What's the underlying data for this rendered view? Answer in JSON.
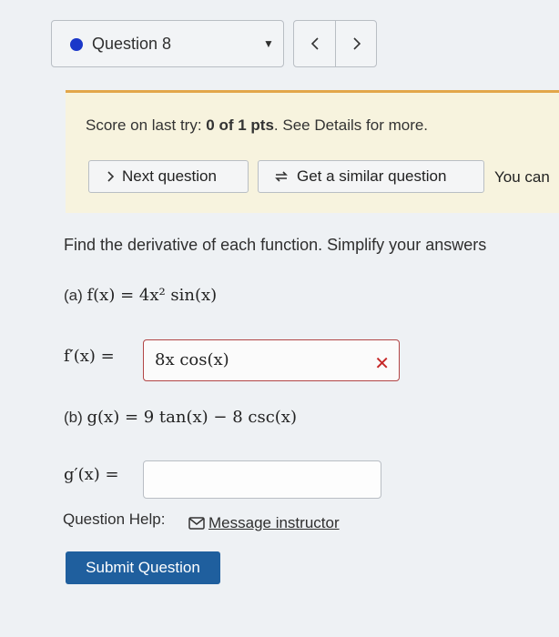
{
  "question_nav": {
    "label": "Question 8",
    "prev_symbol": "‹",
    "next_symbol": "›",
    "dot_color": "#1a37c9"
  },
  "score": {
    "prefix": "Score on last try: ",
    "value": "0 of 1 pts",
    "suffix": ". See Details for more."
  },
  "actions": {
    "next_label": "Next question",
    "similar_label": "Get a similar question",
    "you_can": "You can"
  },
  "prompt": "Find the derivative of each function. Simplify your answers",
  "part_a": {
    "label": "(a) ",
    "function": "f(x) = 4x² sin(x)",
    "answer_label": "f′(x) = ",
    "answer_value": "8x cos(x)",
    "status_icon": "x-icon",
    "status_color": "#c62828"
  },
  "part_b": {
    "label": "(b) ",
    "function": "g(x) = 9 tan(x) − 8 csc(x)",
    "answer_label": "g′(x) = ",
    "answer_value": ""
  },
  "help": {
    "label": "Question Help:",
    "message_label": "Message instructor"
  },
  "submit_label": "Submit Question",
  "colors": {
    "score_banner_bg": "#f7f3de",
    "score_banner_border": "#e2a64a",
    "submit_bg": "#1f5f9e",
    "error_border": "#b24545"
  }
}
